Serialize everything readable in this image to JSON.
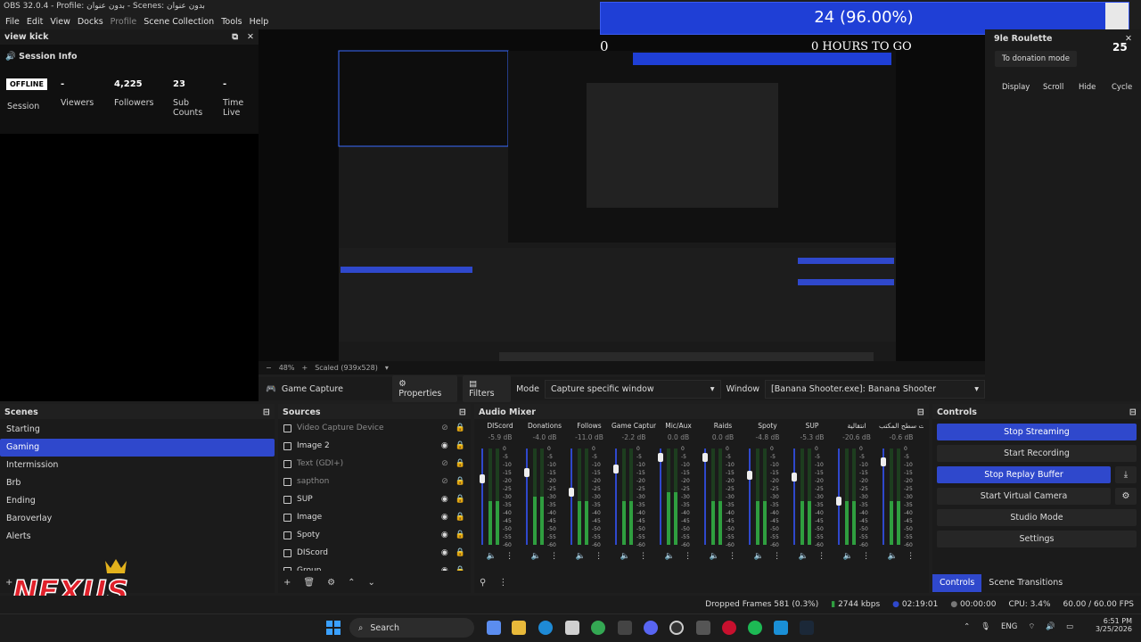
{
  "window": {
    "title": "OBS 32.0.4 - Profile: بدون عنوان - Scenes: بدون عنوان"
  },
  "menu": [
    "File",
    "Edit",
    "View",
    "Docks",
    "Profile",
    "Scene Collection",
    "Tools",
    "Help"
  ],
  "kick": {
    "title": "view kick",
    "session_info": "Session Info",
    "offline": "OFFLINE",
    "session": "Session",
    "stats": [
      {
        "value": "-",
        "label": "Viewers"
      },
      {
        "value": "4,225",
        "label": "Followers"
      },
      {
        "value": "23",
        "label": "Sub Counts"
      },
      {
        "value": "-",
        "label": "Time Live"
      }
    ]
  },
  "overlay": {
    "donation": "24 (96.00%)",
    "zero": "0",
    "hours": "0 HOURS TO GO",
    "progress": 0.96
  },
  "roulette": {
    "title": "9le Roulette",
    "count": "25",
    "donation_mode": "To donation mode",
    "buttons": [
      "Display",
      "Scroll",
      "Hide",
      "Cycle"
    ]
  },
  "preview": {
    "zoom": "48%",
    "scaled": "Scaled (939x528)"
  },
  "source_bar": {
    "source": "Game Capture",
    "properties": "Properties",
    "filters": "Filters",
    "mode_label": "Mode",
    "mode_value": "Capture specific window",
    "window_label": "Window",
    "window_value": "[Banana Shooter.exe]: Banana Shooter"
  },
  "scenes": {
    "title": "Scenes",
    "items": [
      "Starting",
      "Gaming",
      "Intermission",
      "Brb",
      "Ending",
      "Baroverlay",
      "Alerts"
    ],
    "active": 1
  },
  "sources": {
    "title": "Sources",
    "items": [
      {
        "name": "Video Capture Device",
        "dim": true
      },
      {
        "name": "Image 2",
        "dim": false
      },
      {
        "name": "Text (GDI+)",
        "dim": true
      },
      {
        "name": "sapthon",
        "dim": true
      },
      {
        "name": "SUP",
        "dim": false
      },
      {
        "name": "Image",
        "dim": false
      },
      {
        "name": "Spoty",
        "dim": false
      },
      {
        "name": "DIScord",
        "dim": false
      },
      {
        "name": "Group",
        "dim": false
      }
    ]
  },
  "mixer": {
    "title": "Audio Mixer",
    "channels": [
      {
        "name": "DIScord",
        "db": "-5.9 dB",
        "level": 0.7,
        "fill": 0.45
      },
      {
        "name": "Donations",
        "db": "-4.0 dB",
        "level": 0.78,
        "fill": 0.5
      },
      {
        "name": "Follows",
        "db": "-11.0 dB",
        "level": 0.55,
        "fill": 0.45
      },
      {
        "name": "Game Capture",
        "db": "-2.2 dB",
        "level": 0.82,
        "fill": 0.45
      },
      {
        "name": "Mic/Aux",
        "db": "0.0 dB",
        "level": 0.95,
        "fill": 0.55
      },
      {
        "name": "Raids",
        "db": "0.0 dB",
        "level": 0.95,
        "fill": 0.45
      },
      {
        "name": "Spoty",
        "db": "-4.8 dB",
        "level": 0.75,
        "fill": 0.45
      },
      {
        "name": "SUP",
        "db": "-5.3 dB",
        "level": 0.72,
        "fill": 0.45
      },
      {
        "name": "انتقالية",
        "db": "-20.6 dB",
        "level": 0.45,
        "fill": 0.45
      },
      {
        "name": "صوت سطح المكتب",
        "db": "-0.6 dB",
        "level": 0.9,
        "fill": 0.45
      }
    ],
    "scale": [
      "0",
      "-5",
      "-10",
      "-15",
      "-20",
      "-25",
      "-30",
      "-35",
      "-40",
      "-45",
      "-50",
      "-55",
      "-60"
    ]
  },
  "controls": {
    "title": "Controls",
    "stop_streaming": "Stop Streaming",
    "start_recording": "Start Recording",
    "stop_replay": "Stop Replay Buffer",
    "start_virtual": "Start Virtual Camera",
    "studio": "Studio Mode",
    "settings": "Settings"
  },
  "tabs": {
    "controls": "Controls",
    "transitions": "Scene Transitions"
  },
  "status": {
    "dropped": "Dropped Frames 581 (0.3%)",
    "kbps": "2744 kbps",
    "live": "02:19:01",
    "rec": "00:00:00",
    "cpu": "CPU: 3.4%",
    "fps": "60.00 / 60.00 FPS"
  },
  "taskbar": {
    "search": "Search",
    "lang": "ENG",
    "time": "6:51 PM",
    "date": "3/25/2026"
  },
  "colors": {
    "accent": "#2f48cc",
    "meter": "#2f9e3f"
  }
}
